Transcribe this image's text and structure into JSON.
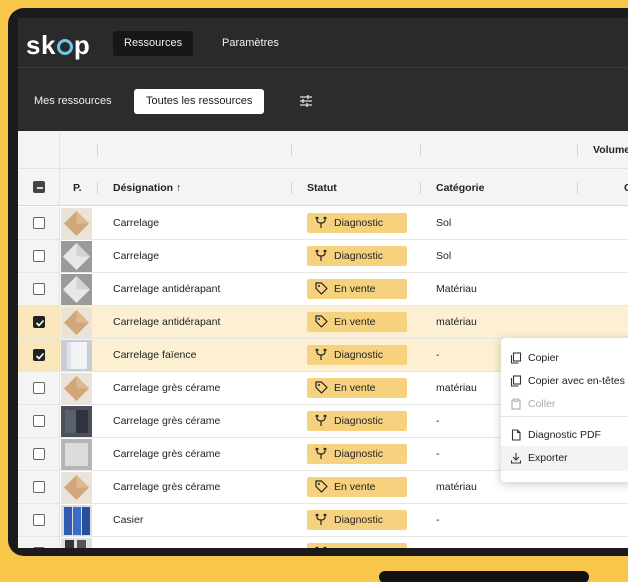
{
  "app": {
    "logo": "skop",
    "nav": [
      "Ressources",
      "Paramètres"
    ]
  },
  "subnav": {
    "tabs": [
      "Mes ressources",
      "Toutes les ressources"
    ],
    "filter_icon": "sliders-icon"
  },
  "table": {
    "group_header": "Volume",
    "columns": [
      "P.",
      "Désignation ↑",
      "Statut",
      "Catégorie",
      "C"
    ],
    "rows": [
      {
        "designation": "Carrelage",
        "statut": "Diagnostic",
        "status_icon": "fork-icon",
        "categorie": "Sol",
        "checked": false,
        "thumb": "beige-diamond"
      },
      {
        "designation": "Carrelage",
        "statut": "Diagnostic",
        "status_icon": "fork-icon",
        "categorie": "Sol",
        "checked": false,
        "thumb": "grey-diamond"
      },
      {
        "designation": "Carrelage antidérapant",
        "statut": "En vente",
        "status_icon": "tag-icon",
        "categorie": "Matériau",
        "checked": false,
        "thumb": "grey-diamond"
      },
      {
        "designation": "Carrelage antidérapant",
        "statut": "En vente",
        "status_icon": "tag-icon",
        "categorie": "matériau",
        "checked": true,
        "thumb": "beige-diamond"
      },
      {
        "designation": "Carrelage faïence",
        "statut": "Diagnostic",
        "status_icon": "fork-icon",
        "categorie": "-",
        "checked": true,
        "thumb": "white-tile"
      },
      {
        "designation": "Carrelage grès cérame",
        "statut": "En vente",
        "status_icon": "tag-icon",
        "categorie": "matériau",
        "checked": false,
        "thumb": "beige-diamond"
      },
      {
        "designation": "Carrelage grès cérame",
        "statut": "Diagnostic",
        "status_icon": "fork-icon",
        "categorie": "-",
        "checked": false,
        "thumb": "dark-tile"
      },
      {
        "designation": "Carrelage grès cérame",
        "statut": "Diagnostic",
        "status_icon": "fork-icon",
        "categorie": "-",
        "checked": false,
        "thumb": "grey-tile"
      },
      {
        "designation": "Carrelage grès cérame",
        "statut": "En vente",
        "status_icon": "tag-icon",
        "categorie": "matériau",
        "checked": false,
        "thumb": "beige-diamond"
      },
      {
        "designation": "Casier",
        "statut": "Diagnostic",
        "status_icon": "fork-icon",
        "categorie": "-",
        "checked": false,
        "thumb": "blue-lockers"
      },
      {
        "designation": "Casier",
        "statut": "Diagnostic",
        "status_icon": "fork-icon",
        "categorie": "-",
        "checked": false,
        "thumb": "dark-lockers"
      }
    ]
  },
  "context_menu": {
    "items": [
      {
        "label": "Copier",
        "icon": "copy-icon",
        "disabled": false
      },
      {
        "label": "Copier avec en-têtes",
        "icon": "copy-icon",
        "disabled": false
      },
      {
        "label": "Coller",
        "icon": "paste-icon",
        "disabled": true
      },
      {
        "label": "Diagnostic PDF",
        "icon": "document-icon",
        "disabled": false
      },
      {
        "label": "Exporter",
        "icon": "download-icon",
        "disabled": false
      }
    ]
  },
  "colors": {
    "background": "#f8c74a",
    "badge": "#f7d27e",
    "selected_row": "#fdf0d2",
    "accent": "#6dc7ef"
  }
}
